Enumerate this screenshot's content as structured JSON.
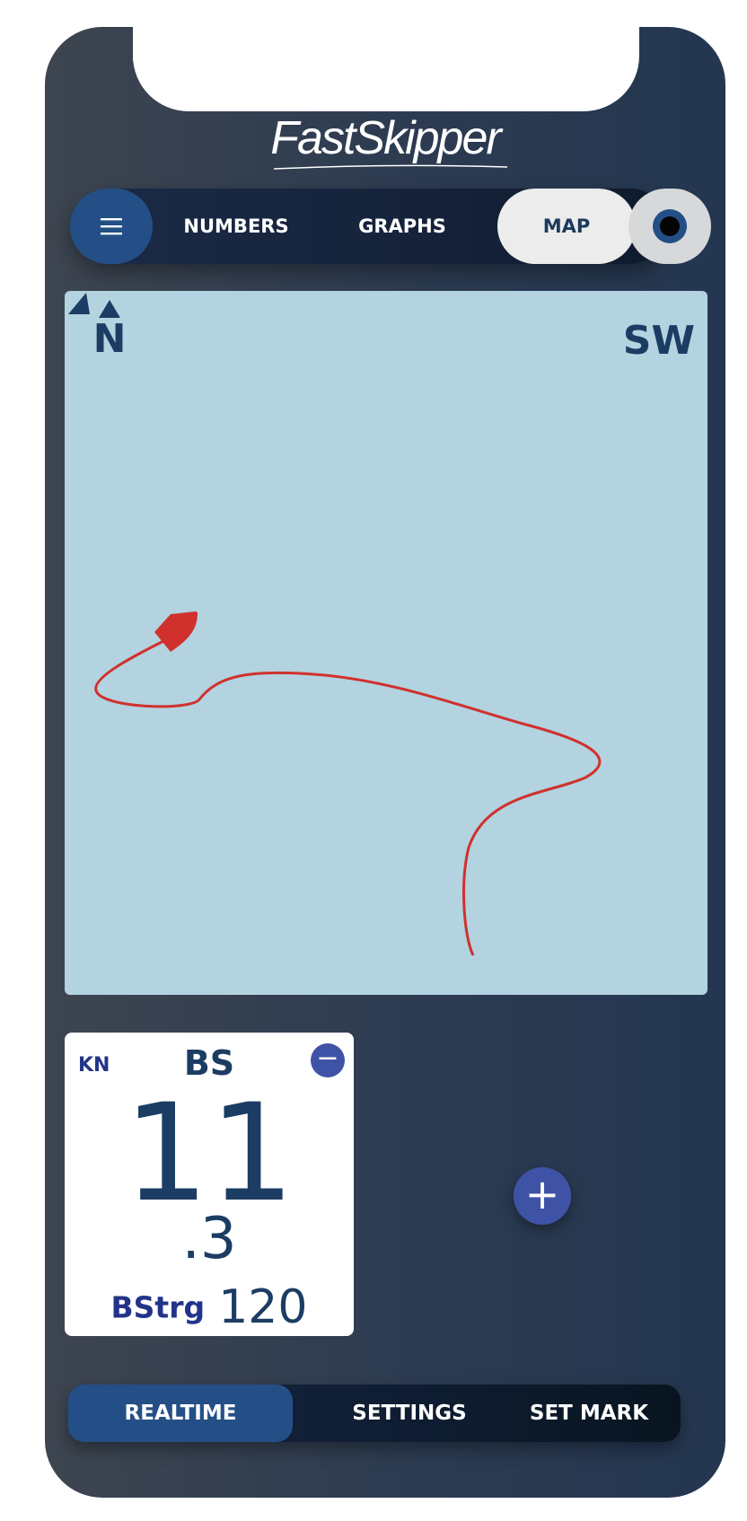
{
  "app": {
    "brand": "FastSkipper"
  },
  "top_nav": {
    "menu_icon": "hamburger-icon",
    "tabs": [
      {
        "label": "NUMBERS",
        "active": false
      },
      {
        "label": "GRAPHS",
        "active": false
      },
      {
        "label": "MAP",
        "active": true
      }
    ],
    "record_icon": "record-icon"
  },
  "map": {
    "north_label": "N",
    "wind_label": "SW",
    "track_color": "#d0312d",
    "water_color": "#b3d3e0",
    "boat_icon": "boat-icon"
  },
  "instrument": {
    "unit": "KN",
    "metric": "BS",
    "value_integer": "11",
    "value_decimal": ".3",
    "secondary_label": "BStrg",
    "secondary_value": "120",
    "remove_symbol": "−"
  },
  "add_instrument": {
    "symbol": "+"
  },
  "bottom_nav": {
    "items": [
      {
        "label": "REALTIME",
        "active": true
      },
      {
        "label": "SETTINGS",
        "active": false
      },
      {
        "label": "SET MARK",
        "active": false
      }
    ]
  },
  "colors": {
    "accent": "#244f86",
    "button_blue": "#3f53a6",
    "text_dark": "#1c3d63"
  }
}
